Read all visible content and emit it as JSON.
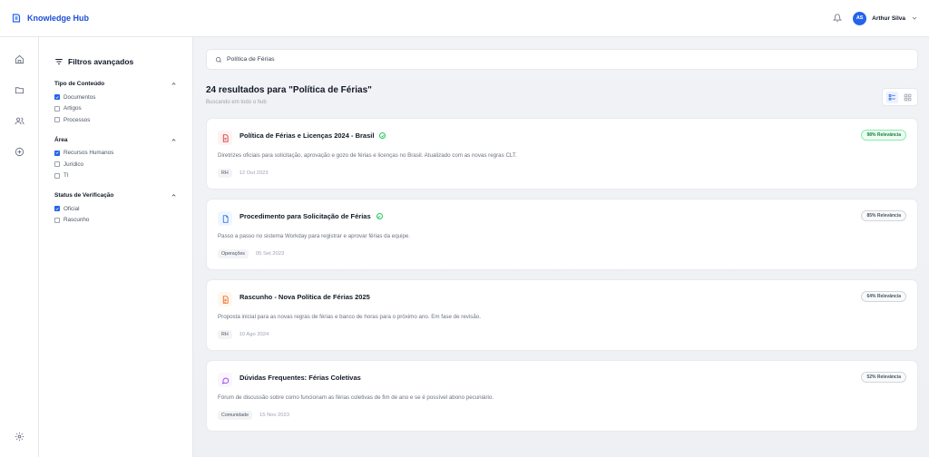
{
  "app": {
    "title": "Knowledge Hub"
  },
  "user": {
    "initials": "AS",
    "name": "Arthur Silva"
  },
  "filters": {
    "title": "Filtros avançados",
    "groups": [
      {
        "label": "Tipo de Conteúdo",
        "options": [
          {
            "label": "Documentos",
            "checked": true
          },
          {
            "label": "Artigos",
            "checked": false
          },
          {
            "label": "Processos",
            "checked": false
          }
        ]
      },
      {
        "label": "Área",
        "options": [
          {
            "label": "Recursos Humanos",
            "checked": true
          },
          {
            "label": "Jurídico",
            "checked": false
          },
          {
            "label": "TI",
            "checked": false
          }
        ]
      },
      {
        "label": "Status de Verificação",
        "options": [
          {
            "label": "Oficial",
            "checked": true
          },
          {
            "label": "Rascunho",
            "checked": false
          }
        ]
      }
    ]
  },
  "search": {
    "value": "Política de Férias"
  },
  "results": {
    "title": "24 resultados para \"Política de Férias\"",
    "subtitle": "Buscando em todo o hub",
    "items": [
      {
        "title": "Política de Férias e Licenças 2024 - Brasil",
        "verified": true,
        "relevance": "98% Relevância",
        "description": "Diretrizes oficiais para solicitação, aprovação e gozo de férias e licenças no Brasil. Atualizado com as novas regras CLT.",
        "tag": "RH",
        "date": "12 Out 2023",
        "icon": "pdf-document-icon"
      },
      {
        "title": "Procedimento para Solicitação de Férias",
        "verified": true,
        "relevance": "85% Relevância",
        "description": "Passo a passo no sistema Workday para registrar e aprovar férias da equipe.",
        "tag": "Operações",
        "date": "05 Set 2023",
        "icon": "document-icon"
      },
      {
        "title": "Rascunho - Nova Política de Férias 2025",
        "verified": false,
        "relevance": "64% Relevância",
        "description": "Proposta inicial para as novas regras de férias e banco de horas para o próximo ano. Em fase de revisão.",
        "tag": "RH",
        "date": "10 Ago 2024",
        "icon": "draft-document-icon"
      },
      {
        "title": "Dúvidas Frequentes: Férias Coletivas",
        "verified": false,
        "relevance": "52% Relevância",
        "description": "Fórum de discussão sobre como funcionam as férias coletivas de fim de ano e se é possível abono pecuniário.",
        "tag": "Comunidade",
        "date": "15 Nov 2023",
        "icon": "chat-bubble-icon"
      }
    ]
  },
  "colors": {
    "accent": "#2563eb",
    "verified": "#22c55e",
    "pdf": "#dc2626",
    "doc": "#2563eb",
    "draft": "#ea580c",
    "chat": "#9333ea"
  }
}
